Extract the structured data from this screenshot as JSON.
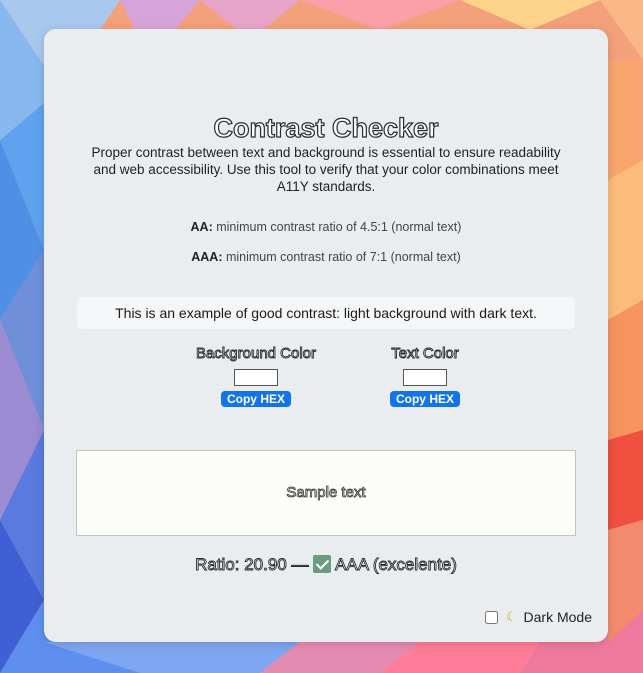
{
  "page": {
    "title": "Contrast Checker",
    "description": "Proper contrast between text and background is essential to ensure readability and web accessibility. Use this tool to verify that your color combinations meet A11Y standards.",
    "standards": [
      {
        "level": "AA:",
        "text": " minimum contrast ratio of 4.5:1 (normal text)"
      },
      {
        "level": "AAA:",
        "text": " minimum contrast ratio of 7:1 (normal text)"
      }
    ],
    "example_text": "This is an example of good contrast: light background with dark text."
  },
  "pickers": {
    "background": {
      "label": "Background Color",
      "button": "Copy HEX",
      "color": "#ffffff"
    },
    "text": {
      "label": "Text Color",
      "button": "Copy HEX",
      "color": "#ffffff"
    }
  },
  "preview": {
    "sample_text": "Sample text"
  },
  "result": {
    "ratio_text": "Ratio: 20.90 —",
    "verdict": "AAA (excelente)"
  },
  "dark_mode": {
    "label": "Dark Mode",
    "checked": false,
    "icon": "moon-icon"
  },
  "colors": {
    "accent": "#1274e8",
    "card_bg": "#e9edf0",
    "check_green": "#6a9d80"
  }
}
